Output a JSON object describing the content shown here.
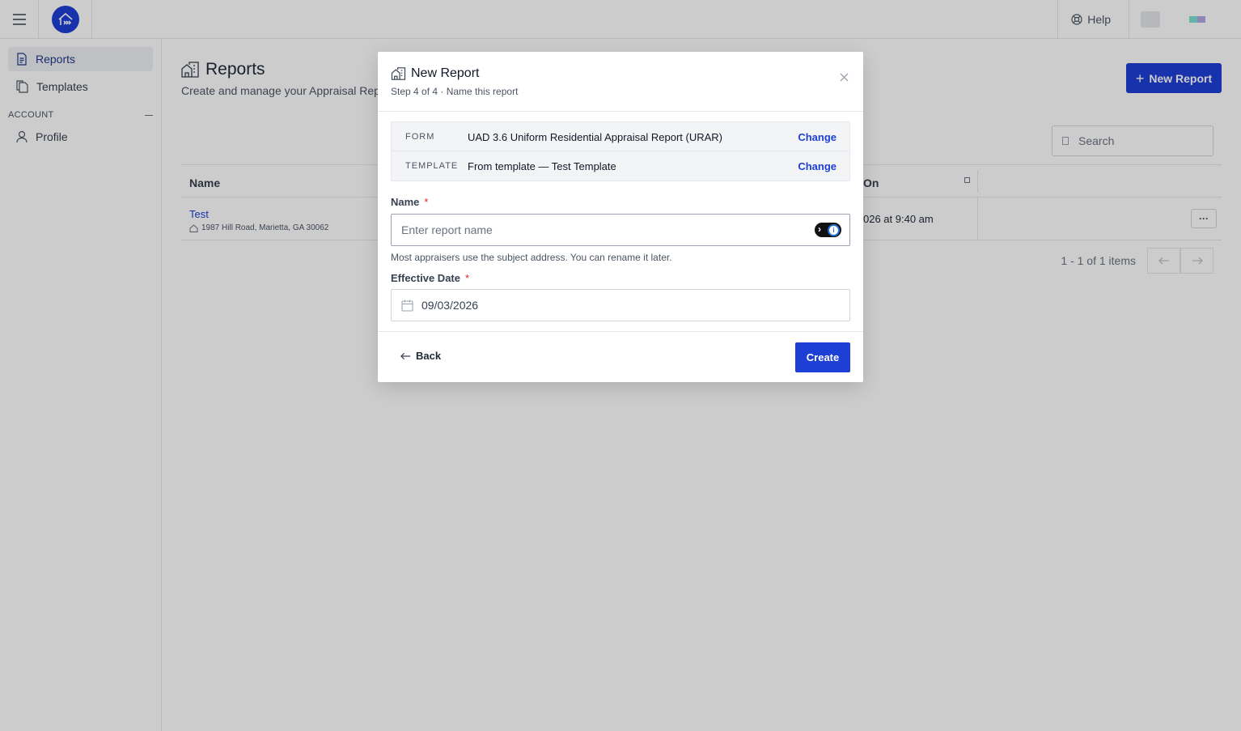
{
  "topbar": {
    "help_label": "Help",
    "chip_colors": [
      "#7ee0d6",
      "#b6a8e6"
    ]
  },
  "sidebar": {
    "items": [
      {
        "label": "Reports",
        "icon": "document-icon",
        "active": true
      },
      {
        "label": "Templates",
        "icon": "copy-icon",
        "active": false
      }
    ],
    "section_label": "ACCOUNT",
    "account_items": [
      {
        "label": "Profile",
        "icon": "user-icon"
      }
    ]
  },
  "page": {
    "title": "Reports",
    "subtitle": "Create and manage your Appraisal Reports",
    "new_report_label": "New Report",
    "search_placeholder": "Search"
  },
  "table": {
    "columns": [
      "Name",
      "On"
    ],
    "rows": [
      {
        "name": "Test",
        "address": "1987 Hill Road, Marietta, GA 30062",
        "date": "026 at 9:40 am"
      }
    ],
    "more_label": "···",
    "pagination": "1 - 1 of 1 items"
  },
  "modal": {
    "title": "New Report",
    "step": "Step 4 of 4 · Name this report",
    "summary": [
      {
        "label": "FORM",
        "value": "UAD 3.6 Uniform Residential Appraisal Report (URAR)",
        "action": "Change"
      },
      {
        "label": "TEMPLATE",
        "value": "From template — Test Template",
        "action": "Change"
      }
    ],
    "name_label": "Name",
    "name_placeholder": "Enter report name",
    "name_value": "",
    "hint": "Most appraisers use the subject address. You can rename it later.",
    "date_label": "Effective Date",
    "date_value": "09/03/2026",
    "back_label": "Back",
    "create_label": "Create",
    "required_mark": "*"
  },
  "colors": {
    "brand": "#1d3fd6",
    "required": "#dc2626"
  }
}
